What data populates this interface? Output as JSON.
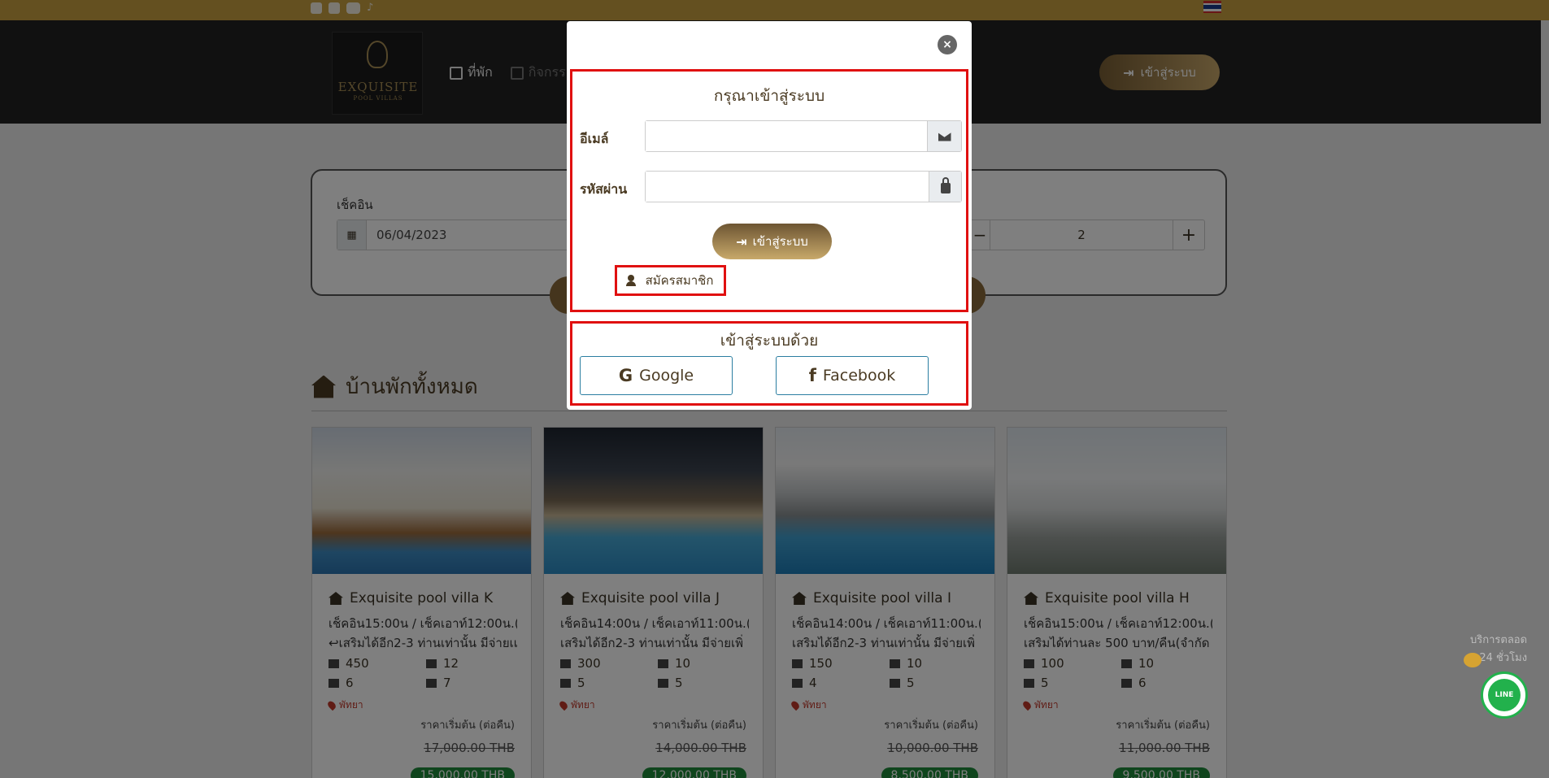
{
  "header": {
    "logo_text": "EXQUISITE",
    "logo_sub": "POOL VILLAS",
    "nav": [
      {
        "label": "ที่พัก"
      },
      {
        "label": "กิจกรร"
      }
    ],
    "login_label": "เข้าสู่ระบบ"
  },
  "search": {
    "checkin_label": "เช็คอิน",
    "checkin_value": "06/04/2023",
    "guests_value": "2",
    "minus": "−",
    "plus": "+"
  },
  "section": {
    "title": "บ้านพักทั้งหมด"
  },
  "cards": [
    {
      "title": "Exquisite pool villa K",
      "line1": "เช็คอิน15:00น / เช็คเอาท์12:00น.(",
      "line2": "↩เสริมได้อีก2-3 ท่านเท่านั้น มีจ่ายเเ",
      "area": "450",
      "guests": "12",
      "beds": "6",
      "baths": "7",
      "location": "พัทยา",
      "price_from": "ราคาเริ่มต้น (ต่อคืน)",
      "old_price": "17,000.00 THB",
      "new_price": "15,000.00 THB"
    },
    {
      "title": "Exquisite pool villa J",
      "line1": "เช็คอิน14:00น / เช็คเอาท์11:00น.(",
      "line2": "เสริมได้อีก2-3 ท่านเท่านั้น มีจ่ายเพิ่",
      "area": "300",
      "guests": "10",
      "beds": "5",
      "baths": "5",
      "location": "พัทยา",
      "price_from": "ราคาเริ่มต้น (ต่อคืน)",
      "old_price": "14,000.00 THB",
      "new_price": "12,000.00 THB"
    },
    {
      "title": "Exquisite pool villa I",
      "line1": "เช็คอิน14:00น / เช็คเอาท์11:00น.(",
      "line2": "เสริมได้อีก2-3 ท่านเท่านั้น มีจ่ายเพิ่",
      "area": "150",
      "guests": "10",
      "beds": "4",
      "baths": "5",
      "location": "พัทยา",
      "price_from": "ราคาเริ่มต้น (ต่อคืน)",
      "old_price": "10,000.00 THB",
      "new_price": "8,500.00 THB"
    },
    {
      "title": "Exquisite pool villa H",
      "line1": "เช็คอิน15:00น / เช็คเอาท์12:00น.(",
      "line2": "เสริมได้ท่านละ 500 บาท/คืน(จำกัด",
      "area": "100",
      "guests": "10",
      "beds": "5",
      "baths": "6",
      "location": "พัทยา",
      "price_from": "ราคาเริ่มต้น (ต่อคืน)",
      "old_price": "11,000.00 THB",
      "new_price": "9,500.00 THB"
    }
  ],
  "contact": {
    "line1": "บริการตลอด",
    "line2": "24 ชั่วโมง",
    "line_label": "LINE"
  },
  "modal": {
    "close": "×",
    "title": "กรุณาเข้าสู่ระบบ",
    "email_label": "อีเมล์",
    "password_label": "รหัสผ่าน",
    "login_label": "เข้าสู่ระบบ",
    "register_label": "สมัครสมาชิก",
    "social_title": "เข้าสู่ระบบด้วย",
    "google_label": "Google",
    "facebook_label": "Facebook"
  },
  "colors": {
    "top_strip": "#c8a040",
    "header_bg": "#222222",
    "gold_button": "#c9a86a",
    "highlight_border": "#e01010",
    "price_badge": "#1f8a3a"
  }
}
